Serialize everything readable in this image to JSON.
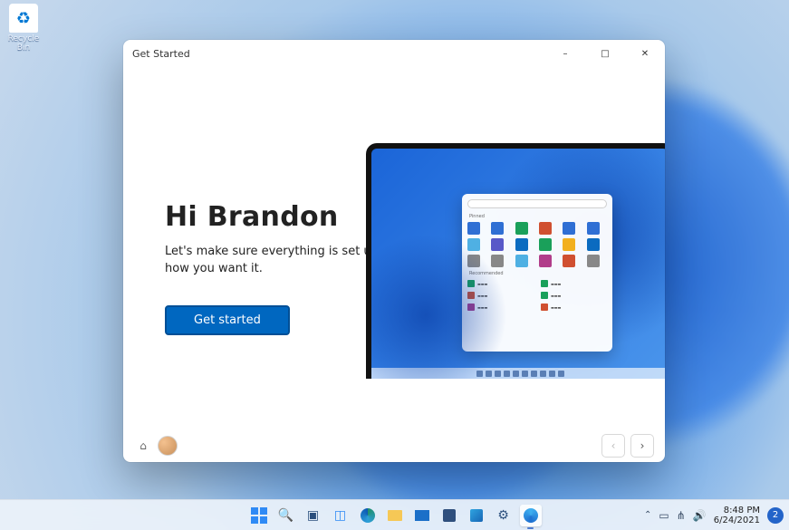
{
  "desktop": {
    "recycle_bin_label": "Recycle Bin"
  },
  "window": {
    "title": "Get Started",
    "heading": "Hi Brandon",
    "subheading": "Let's make sure everything is set up how you want it.",
    "cta_label": "Get started"
  },
  "illustration": {
    "pinned_label": "Pinned",
    "recommended_label": "Recommended"
  },
  "taskbar": {
    "icons": [
      "start",
      "search",
      "task-view",
      "widgets",
      "edge",
      "file-explorer",
      "mail",
      "store",
      "photos",
      "settings",
      "get-started"
    ]
  },
  "tray": {
    "time": "8:48 PM",
    "date": "6/24/2021",
    "notification_count": "2"
  }
}
